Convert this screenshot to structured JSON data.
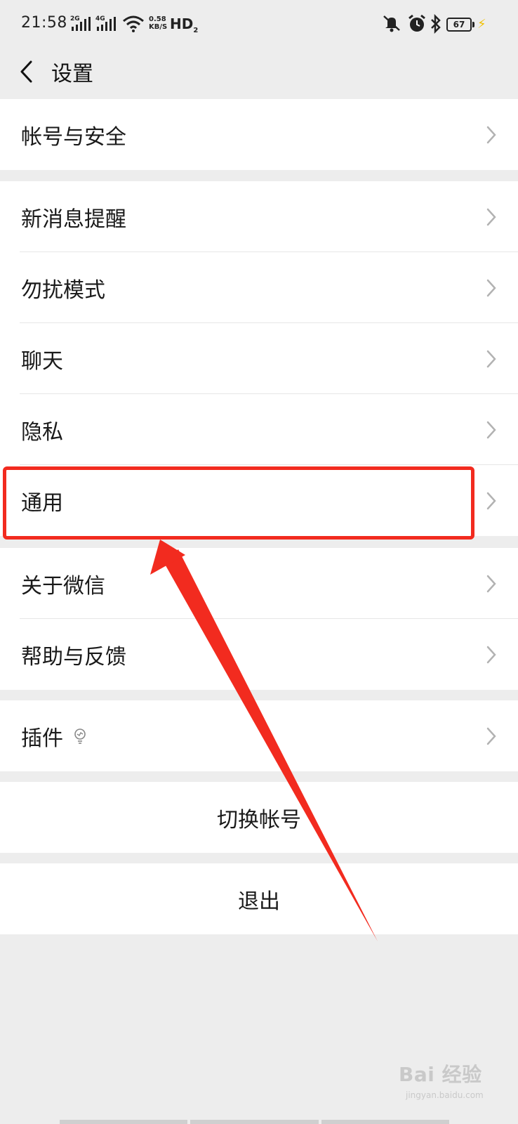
{
  "status_bar": {
    "time": "21:58",
    "signal_1_tag": "2G",
    "signal_2_tag": "4G",
    "net_speed_value": "0.58",
    "net_speed_unit": "KB/S",
    "hd_label": "HD",
    "hd_sub": "2",
    "battery_level": "67",
    "icons": [
      "signal-icon",
      "wifi-icon",
      "mute-icon",
      "alarm-icon",
      "bluetooth-icon",
      "battery-icon",
      "charging-icon"
    ]
  },
  "header": {
    "title": "设置",
    "back_icon": "chevron-left-icon"
  },
  "groups": {
    "account": {
      "items": [
        {
          "label": "帐号与安全"
        }
      ]
    },
    "settings": {
      "items": [
        {
          "label": "新消息提醒"
        },
        {
          "label": "勿扰模式"
        },
        {
          "label": "聊天"
        },
        {
          "label": "隐私"
        },
        {
          "label": "通用"
        }
      ]
    },
    "about": {
      "items": [
        {
          "label": "关于微信"
        },
        {
          "label": "帮助与反馈"
        }
      ]
    },
    "plugins": {
      "items": [
        {
          "label": "插件",
          "icon": "lightbulb-icon"
        }
      ]
    }
  },
  "actions": {
    "switch_account": "切换帐号",
    "logout": "退出"
  },
  "annotation": {
    "highlight_color": "#f22b1f",
    "highlighted_item": "通用"
  },
  "watermark": {
    "brand": "Bai 经验",
    "sub": "jingyan.baidu.com"
  },
  "colors": {
    "background": "#ededed",
    "card": "#ffffff",
    "text": "#1a1a1a",
    "chevron": "#b2b2b2",
    "annotation": "#f22b1f"
  }
}
